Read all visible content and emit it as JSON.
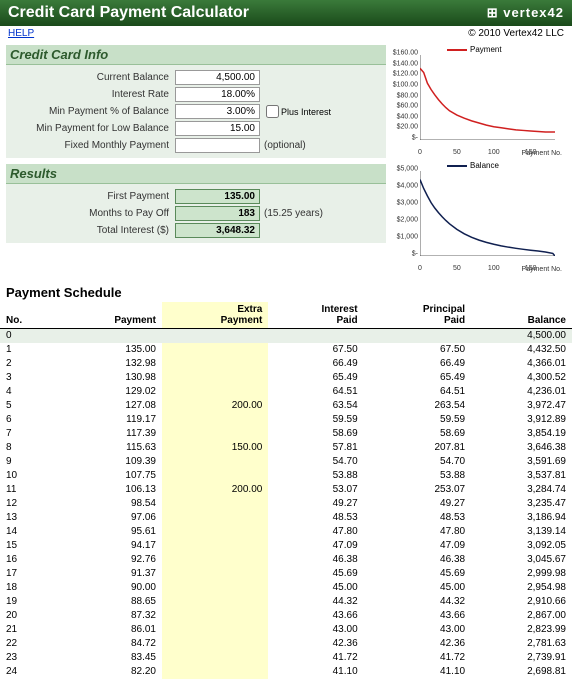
{
  "title": "Credit Card Payment Calculator",
  "logo": "vertex42",
  "help_label": "HELP",
  "copyright": "© 2010 Vertex42 LLC",
  "info": {
    "header": "Credit Card Info",
    "current_balance_label": "Current Balance",
    "current_balance": "4,500.00",
    "interest_rate_label": "Interest Rate",
    "interest_rate": "18.00%",
    "min_pct_label": "Min Payment % of Balance",
    "min_pct": "3.00%",
    "plus_interest_label": "Plus Interest",
    "min_low_label": "Min Payment for Low Balance",
    "min_low": "15.00",
    "fixed_label": "Fixed Monthly Payment",
    "fixed": "",
    "optional": "(optional)"
  },
  "results": {
    "header": "Results",
    "first_payment_label": "First Payment",
    "first_payment": "135.00",
    "months_label": "Months to Pay Off",
    "months": "183",
    "years_note": "(15.25 years)",
    "total_interest_label": "Total Interest ($)",
    "total_interest": "3,648.32"
  },
  "chart_data": [
    {
      "type": "line",
      "title": "Payment",
      "color": "#d02020",
      "xlabel": "Payment No.",
      "ylim": [
        0,
        160
      ],
      "yticks": [
        "$160.00",
        "$140.00",
        "$120.00",
        "$100.00",
        "$80.00",
        "$60.00",
        "$40.00",
        "$20.00",
        "$-"
      ],
      "xticks": [
        0,
        50,
        100,
        150
      ],
      "x": [
        0,
        5,
        10,
        15,
        20,
        25,
        30,
        35,
        40,
        50,
        60,
        70,
        80,
        90,
        100,
        110,
        120,
        130,
        140,
        150,
        160,
        170,
        180,
        183
      ],
      "values": [
        135,
        127,
        107,
        95,
        85,
        76,
        68,
        61,
        55,
        47,
        41,
        36,
        32,
        28,
        25,
        23,
        21,
        19,
        18,
        17,
        16,
        15,
        15,
        15
      ]
    },
    {
      "type": "line",
      "title": "Balance",
      "color": "#102050",
      "xlabel": "Payment No.",
      "ylim": [
        0,
        5000
      ],
      "yticks": [
        "$5,000",
        "$4,000",
        "$3,000",
        "$2,000",
        "$1,000",
        "$-"
      ],
      "xticks": [
        0,
        50,
        100,
        150
      ],
      "x": [
        0,
        5,
        10,
        15,
        20,
        25,
        30,
        35,
        40,
        50,
        60,
        70,
        80,
        90,
        100,
        110,
        120,
        130,
        140,
        150,
        160,
        170,
        180,
        183
      ],
      "values": [
        4500,
        3972,
        3538,
        3139,
        2824,
        2552,
        2307,
        2090,
        1894,
        1565,
        1305,
        1099,
        935,
        801,
        690,
        598,
        519,
        452,
        393,
        341,
        291,
        238,
        153,
        0
      ]
    }
  ],
  "schedule_header": "Payment Schedule",
  "schedule_columns": {
    "no": "No.",
    "payment": "Payment",
    "extra": "Extra\nPayment",
    "interest": "Interest\nPaid",
    "principal": "Principal\nPaid",
    "balance": "Balance"
  },
  "schedule": [
    {
      "no": "0",
      "payment": "",
      "extra": "",
      "interest": "",
      "principal": "",
      "balance": "4,500.00"
    },
    {
      "no": "1",
      "payment": "135.00",
      "extra": "",
      "interest": "67.50",
      "principal": "67.50",
      "balance": "4,432.50"
    },
    {
      "no": "2",
      "payment": "132.98",
      "extra": "",
      "interest": "66.49",
      "principal": "66.49",
      "balance": "4,366.01"
    },
    {
      "no": "3",
      "payment": "130.98",
      "extra": "",
      "interest": "65.49",
      "principal": "65.49",
      "balance": "4,300.52"
    },
    {
      "no": "4",
      "payment": "129.02",
      "extra": "",
      "interest": "64.51",
      "principal": "64.51",
      "balance": "4,236.01"
    },
    {
      "no": "5",
      "payment": "127.08",
      "extra": "200.00",
      "interest": "63.54",
      "principal": "263.54",
      "balance": "3,972.47"
    },
    {
      "no": "6",
      "payment": "119.17",
      "extra": "",
      "interest": "59.59",
      "principal": "59.59",
      "balance": "3,912.89"
    },
    {
      "no": "7",
      "payment": "117.39",
      "extra": "",
      "interest": "58.69",
      "principal": "58.69",
      "balance": "3,854.19"
    },
    {
      "no": "8",
      "payment": "115.63",
      "extra": "150.00",
      "interest": "57.81",
      "principal": "207.81",
      "balance": "3,646.38"
    },
    {
      "no": "9",
      "payment": "109.39",
      "extra": "",
      "interest": "54.70",
      "principal": "54.70",
      "balance": "3,591.69"
    },
    {
      "no": "10",
      "payment": "107.75",
      "extra": "",
      "interest": "53.88",
      "principal": "53.88",
      "balance": "3,537.81"
    },
    {
      "no": "11",
      "payment": "106.13",
      "extra": "200.00",
      "interest": "53.07",
      "principal": "253.07",
      "balance": "3,284.74"
    },
    {
      "no": "12",
      "payment": "98.54",
      "extra": "",
      "interest": "49.27",
      "principal": "49.27",
      "balance": "3,235.47"
    },
    {
      "no": "13",
      "payment": "97.06",
      "extra": "",
      "interest": "48.53",
      "principal": "48.53",
      "balance": "3,186.94"
    },
    {
      "no": "14",
      "payment": "95.61",
      "extra": "",
      "interest": "47.80",
      "principal": "47.80",
      "balance": "3,139.14"
    },
    {
      "no": "15",
      "payment": "94.17",
      "extra": "",
      "interest": "47.09",
      "principal": "47.09",
      "balance": "3,092.05"
    },
    {
      "no": "16",
      "payment": "92.76",
      "extra": "",
      "interest": "46.38",
      "principal": "46.38",
      "balance": "3,045.67"
    },
    {
      "no": "17",
      "payment": "91.37",
      "extra": "",
      "interest": "45.69",
      "principal": "45.69",
      "balance": "2,999.98"
    },
    {
      "no": "18",
      "payment": "90.00",
      "extra": "",
      "interest": "45.00",
      "principal": "45.00",
      "balance": "2,954.98"
    },
    {
      "no": "19",
      "payment": "88.65",
      "extra": "",
      "interest": "44.32",
      "principal": "44.32",
      "balance": "2,910.66"
    },
    {
      "no": "20",
      "payment": "87.32",
      "extra": "",
      "interest": "43.66",
      "principal": "43.66",
      "balance": "2,867.00"
    },
    {
      "no": "21",
      "payment": "86.01",
      "extra": "",
      "interest": "43.00",
      "principal": "43.00",
      "balance": "2,823.99"
    },
    {
      "no": "22",
      "payment": "84.72",
      "extra": "",
      "interest": "42.36",
      "principal": "42.36",
      "balance": "2,781.63"
    },
    {
      "no": "23",
      "payment": "83.45",
      "extra": "",
      "interest": "41.72",
      "principal": "41.72",
      "balance": "2,739.91"
    },
    {
      "no": "24",
      "payment": "82.20",
      "extra": "",
      "interest": "41.10",
      "principal": "41.10",
      "balance": "2,698.81"
    }
  ]
}
